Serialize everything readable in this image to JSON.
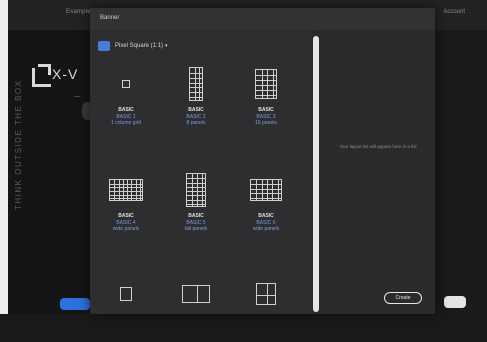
{
  "background": {
    "topbar_left": "Example",
    "topbar_right": "Account",
    "tagline": "THINK OUTSIDE THE BOX",
    "logo_text": "X-V",
    "logo_sub": "—"
  },
  "dialog": {
    "title": "Banner",
    "title_sub": "",
    "format_selector": {
      "icon": "image-format-icon",
      "label": "Pixel Square (1:1)",
      "caret": "▾"
    },
    "grid_cells": [
      {
        "title": "BASIC",
        "line1": "BASIC 1",
        "line2": "1 column grid",
        "shape": "single"
      },
      {
        "title": "BASIC",
        "line1": "BASIC 2",
        "line2": "8 panels",
        "shape": "tall-grid"
      },
      {
        "title": "BASIC",
        "line1": "BASIC 3",
        "line2": "16 panels",
        "shape": "square-grid"
      },
      {
        "title": "BASIC",
        "line1": "BASIC 4",
        "line2": "wide panels",
        "shape": "wide-grid"
      },
      {
        "title": "BASIC",
        "line1": "BASIC 5",
        "line2": "tall panels",
        "shape": "tall-grid-2"
      },
      {
        "title": "BASIC",
        "line1": "BASIC 6",
        "line2": "wide panels",
        "shape": "wide-grid-2"
      },
      {
        "title": "",
        "line1": "",
        "line2": "",
        "shape": "single-small"
      },
      {
        "title": "",
        "line1": "",
        "line2": "",
        "shape": "two-col"
      },
      {
        "title": "",
        "line1": "",
        "line2": "",
        "shape": "four-grid"
      }
    ],
    "right_panel_message": "Your layout list will appear here in a list",
    "create_button": "Create"
  },
  "colors": {
    "accent_blue": "#2f6fe0",
    "panel": "#2e2e30",
    "link_text": "#7d9ce0"
  }
}
